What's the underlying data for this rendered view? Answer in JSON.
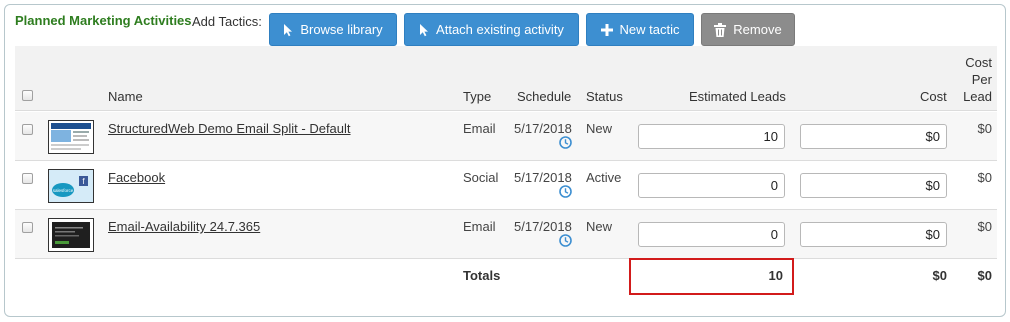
{
  "section": {
    "title": "Planned Marketing Activities",
    "add_label": "Add Tactics:"
  },
  "toolbar": {
    "browse_label": "Browse library",
    "attach_label": "Attach existing activity",
    "new_label": "New tactic",
    "remove_label": "Remove"
  },
  "table": {
    "headers": {
      "name": "Name",
      "type": "Type",
      "schedule": "Schedule",
      "status": "Status",
      "leads": "Estimated Leads",
      "cost": "Cost",
      "cpl_1": "Cost",
      "cpl_2": "Per",
      "cpl_3": "Lead"
    },
    "rows": [
      {
        "name": "StructuredWeb Demo Email Split - Default",
        "type": "Email",
        "schedule": "5/17/2018",
        "status": "New",
        "leads": "10",
        "cost": "$0",
        "cpl": "$0"
      },
      {
        "name": "Facebook",
        "type": "Social",
        "schedule": "5/17/2018",
        "status": "Active",
        "leads": "0",
        "cost": "$0",
        "cpl": "$0"
      },
      {
        "name": "Email-Availability 24.7.365",
        "type": "Email",
        "schedule": "5/17/2018",
        "status": "New",
        "leads": "0",
        "cost": "$0",
        "cpl": "$0"
      }
    ],
    "totals": {
      "label": "Totals",
      "leads": "10",
      "cost": "$0",
      "cpl": "$0"
    }
  },
  "thumbnails": {
    "facebook_brand": "salesforce"
  },
  "colors": {
    "accent_blue": "#3d8fd1",
    "title_green": "#2e7d1f",
    "highlight_red": "#d21b1b",
    "remove_gray": "#8c8c8c"
  }
}
